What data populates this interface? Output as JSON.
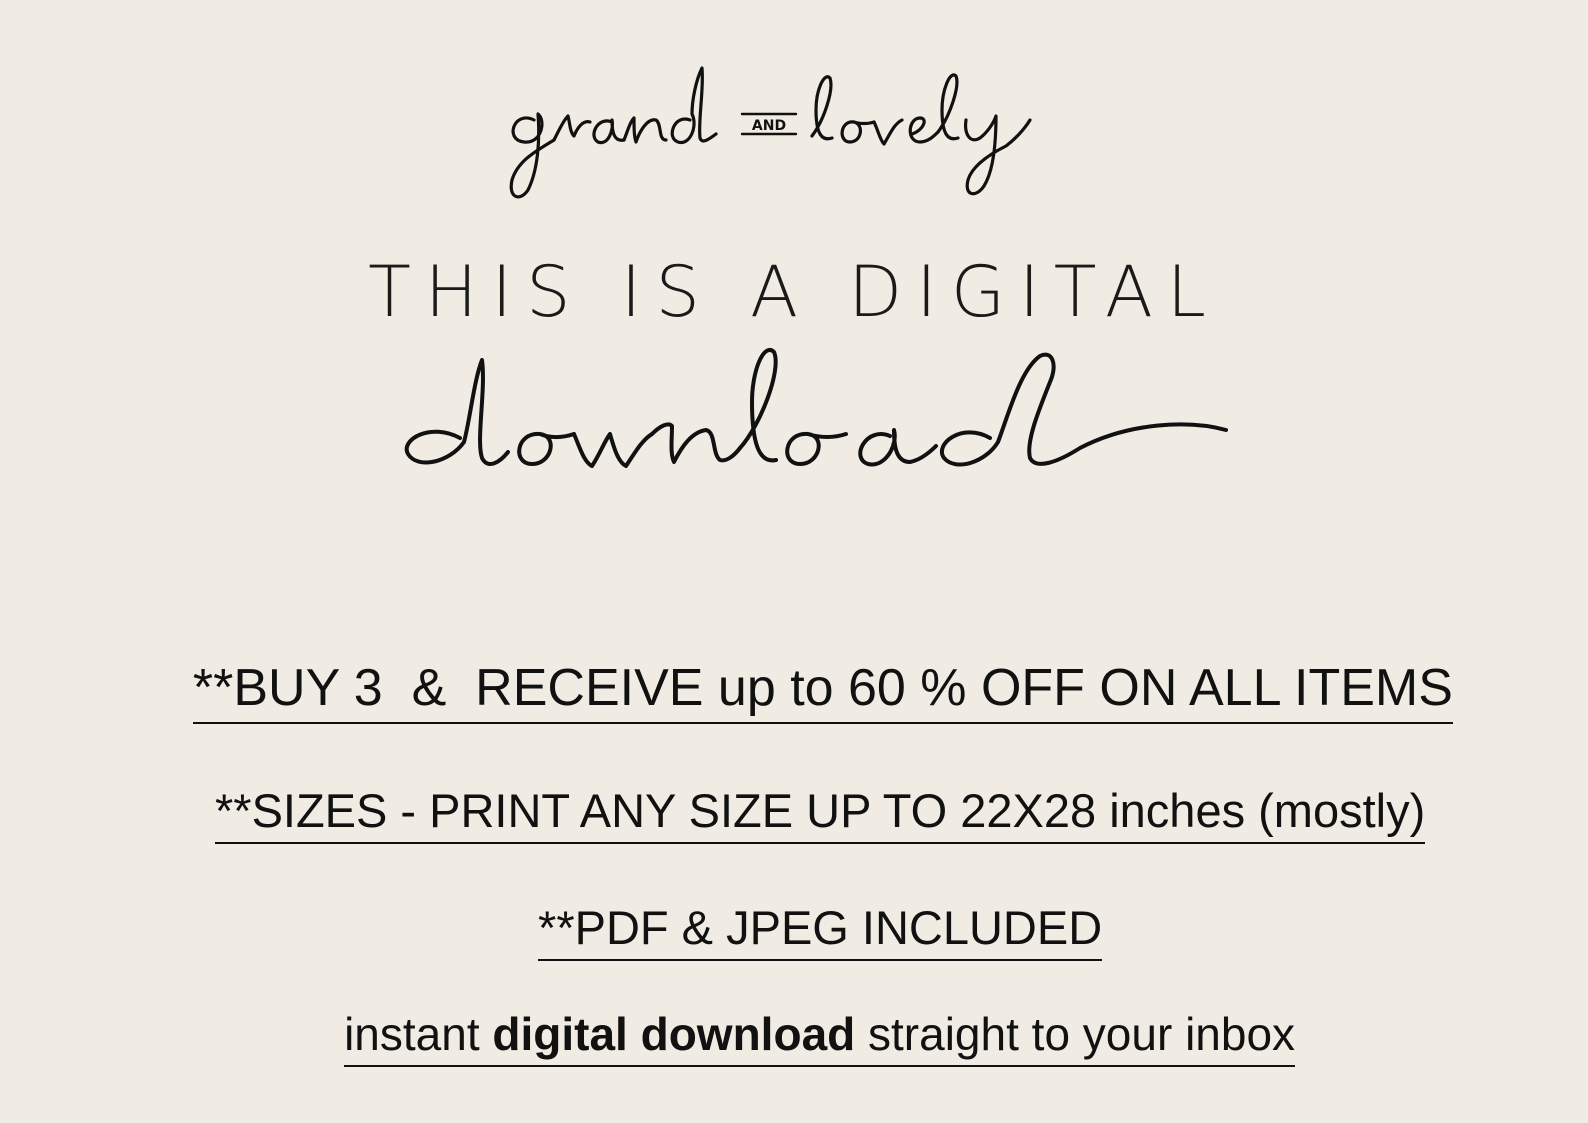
{
  "brand": {
    "logo_text": "grand and lovely"
  },
  "headline": {
    "text": "THIS IS A DIGITAL",
    "script_word": "download"
  },
  "info": {
    "line1": "**BUY 3  &  RECEIVE up to 60 % OFF ON ALL ITEMS",
    "line2": "**SIZES - PRINT ANY SIZE UP TO 22X28 inches (mostly)",
    "line3": "**PDF & JPEG INCLUDED",
    "line4_prefix": "instant ",
    "line4_bold": "digital download",
    "line4_suffix": " straight to your inbox"
  },
  "colors": {
    "background": "#f0ece4",
    "text": "#111111"
  }
}
